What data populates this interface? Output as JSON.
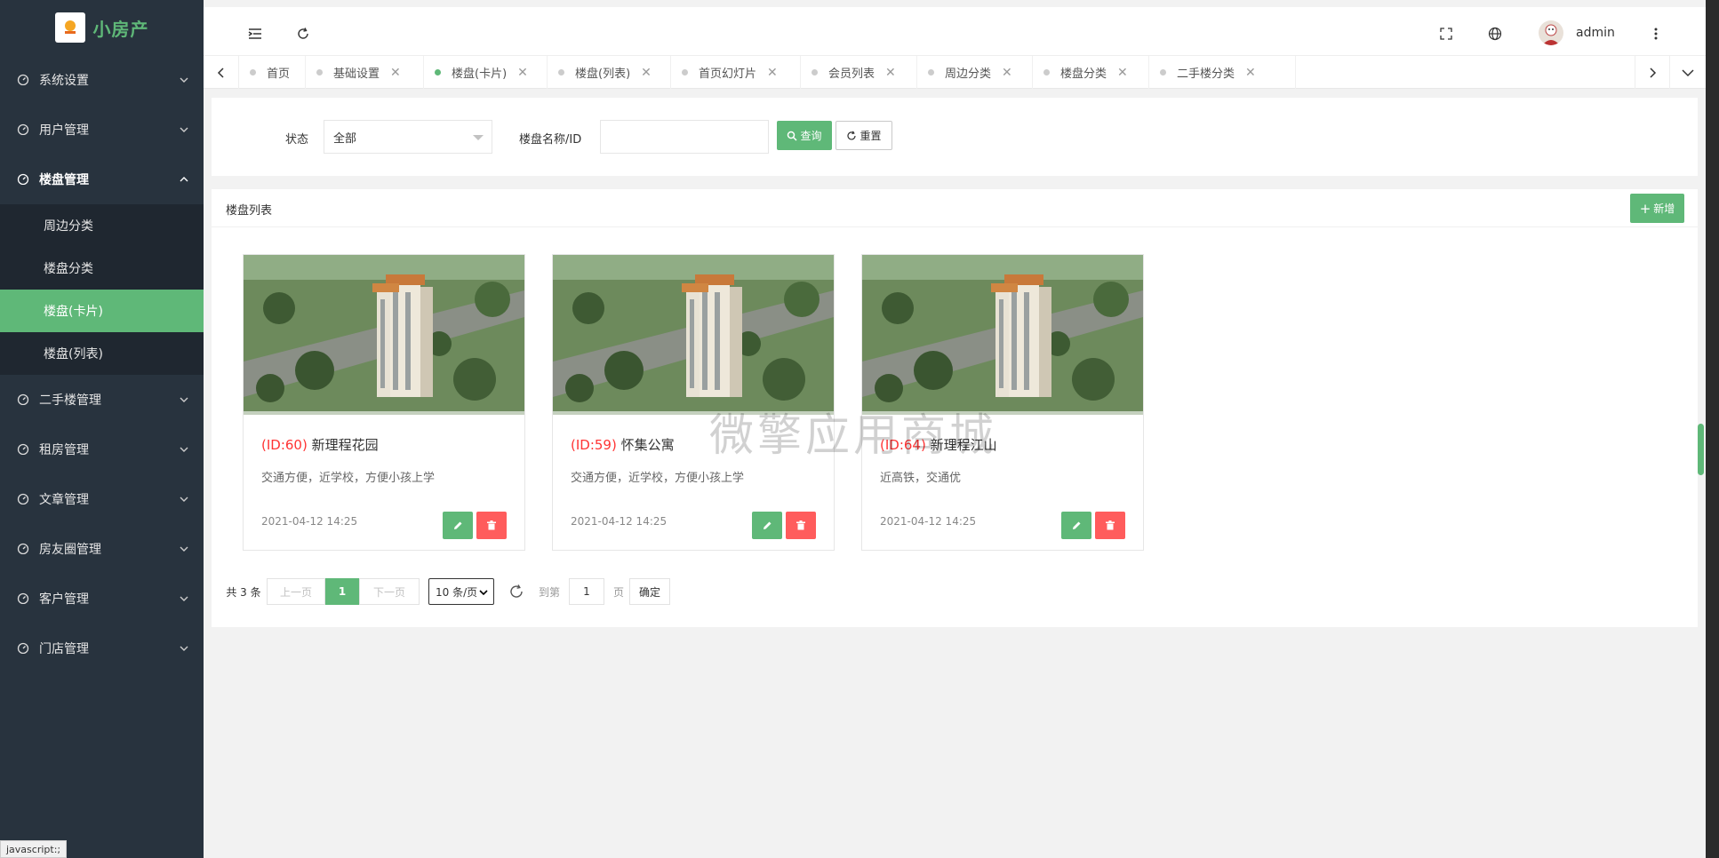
{
  "app": {
    "name": "小房产"
  },
  "sidebar": {
    "items": [
      {
        "label": "系统设置"
      },
      {
        "label": "用户管理"
      },
      {
        "label": "楼盘管理",
        "children": [
          {
            "label": "周边分类"
          },
          {
            "label": "楼盘分类"
          },
          {
            "label": "楼盘(卡片)",
            "active": true
          },
          {
            "label": "楼盘(列表)"
          }
        ]
      },
      {
        "label": "二手楼管理"
      },
      {
        "label": "租房管理"
      },
      {
        "label": "文章管理"
      },
      {
        "label": "房友圈管理"
      },
      {
        "label": "客户管理"
      },
      {
        "label": "门店管理"
      }
    ]
  },
  "header": {
    "user": "admin"
  },
  "tabs": [
    "首页",
    "基础设置",
    "楼盘(卡片)",
    "楼盘(列表)",
    "首页幻灯片",
    "会员列表",
    "周边分类",
    "楼盘分类",
    "二手楼分类"
  ],
  "active_tab": "楼盘(卡片)",
  "filter": {
    "status_label": "状态",
    "status_value": "全部",
    "name_label": "楼盘名称/ID",
    "name_value": "",
    "search_button": "查询",
    "reset_button": "重置"
  },
  "list": {
    "title": "楼盘列表",
    "add_button": "新增",
    "cards": [
      {
        "id_text": "(ID:60)",
        "name": "新理程花园",
        "desc": "交通方便，近学校，方便小孩上学",
        "date": "2021-04-12 14:25"
      },
      {
        "id_text": "(ID:59)",
        "name": "怀集公寓",
        "desc": "交通方便，近学校，方便小孩上学",
        "date": "2021-04-12 14:25"
      },
      {
        "id_text": "(ID:64)",
        "name": "新理程江山",
        "desc": "近高铁，交通优",
        "date": "2021-04-12 14:25"
      }
    ]
  },
  "pagination": {
    "total": "共 3 条",
    "prev": "上一页",
    "current": "1",
    "next": "下一页",
    "page_size": "10 条/页",
    "goto_label": "到第",
    "goto_value": "1",
    "page_unit": "页",
    "confirm": "确定"
  },
  "watermark": "微擎应用商城",
  "statusbar": "javascript:;",
  "colors": {
    "accent": "#5fb878",
    "danger": "#ff5c5c",
    "sidebar": "#28333e",
    "id_red": "#ff3333"
  }
}
